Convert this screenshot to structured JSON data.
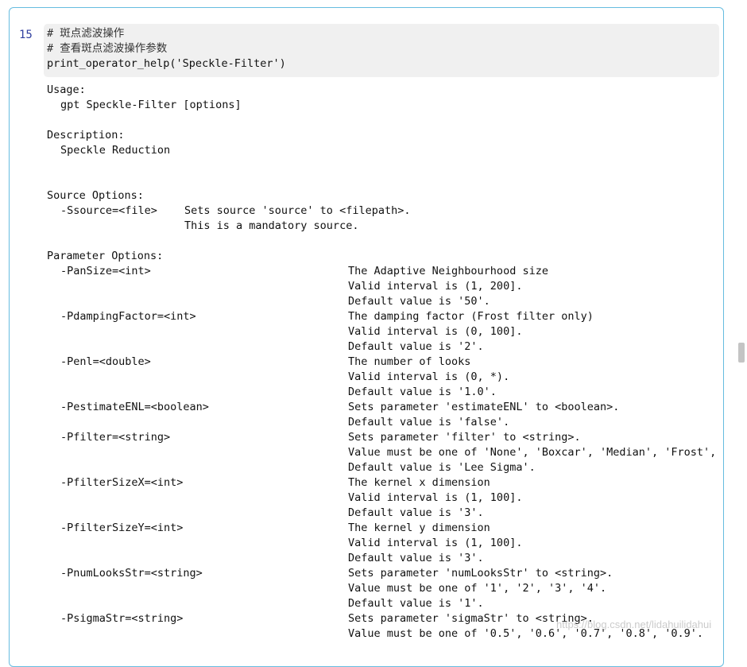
{
  "cell": {
    "prompt": "15",
    "code": [
      "# 斑点滤波操作",
      "# 查看斑点滤波操作参数",
      "print_operator_help('Speckle-Filter')"
    ]
  },
  "output": {
    "usage_header": "Usage:",
    "usage_line": "gpt Speckle-Filter [options]",
    "description_header": "Description:",
    "description_line": "Speckle Reduction",
    "source_header": "Source Options:",
    "source_option": "-Ssource=<file>",
    "source_desc": [
      "Sets source 'source' to <filepath>.",
      "This is a mandatory source."
    ],
    "param_header": "Parameter Options:",
    "params": [
      {
        "name": "-PanSize=<int>",
        "desc": [
          "The Adaptive Neighbourhood size",
          "Valid interval is (1, 200].",
          "Default value is '50'."
        ]
      },
      {
        "name": "-PdampingFactor=<int>",
        "desc": [
          "The damping factor (Frost filter only)",
          "Valid interval is (0, 100].",
          "Default value is '2'."
        ]
      },
      {
        "name": "-Penl=<double>",
        "desc": [
          "The number of looks",
          "Valid interval is (0, *).",
          "Default value is '1.0'."
        ]
      },
      {
        "name": "-PestimateENL=<boolean>",
        "desc": [
          "Sets parameter 'estimateENL' to <boolean>.",
          "Default value is 'false'."
        ]
      },
      {
        "name": "-Pfilter=<string>",
        "desc": [
          "Sets parameter 'filter' to <string>.",
          "Value must be one of 'None', 'Boxcar', 'Median', 'Frost',",
          "Default value is 'Lee Sigma'."
        ]
      },
      {
        "name": "-PfilterSizeX=<int>",
        "desc": [
          "The kernel x dimension",
          "Valid interval is (1, 100].",
          "Default value is '3'."
        ]
      },
      {
        "name": "-PfilterSizeY=<int>",
        "desc": [
          "The kernel y dimension",
          "Valid interval is (1, 100].",
          "Default value is '3'."
        ]
      },
      {
        "name": "-PnumLooksStr=<string>",
        "desc": [
          "Sets parameter 'numLooksStr' to <string>.",
          "Value must be one of '1', '2', '3', '4'.",
          "Default value is '1'."
        ]
      },
      {
        "name": "-PsigmaStr=<string>",
        "desc": [
          "Sets parameter 'sigmaStr' to <string>.",
          "Value must be one of '0.5', '0.6', '0.7', '0.8', '0.9'."
        ]
      }
    ]
  },
  "watermark": "https://blog.csdn.net/lidahuilidahui"
}
